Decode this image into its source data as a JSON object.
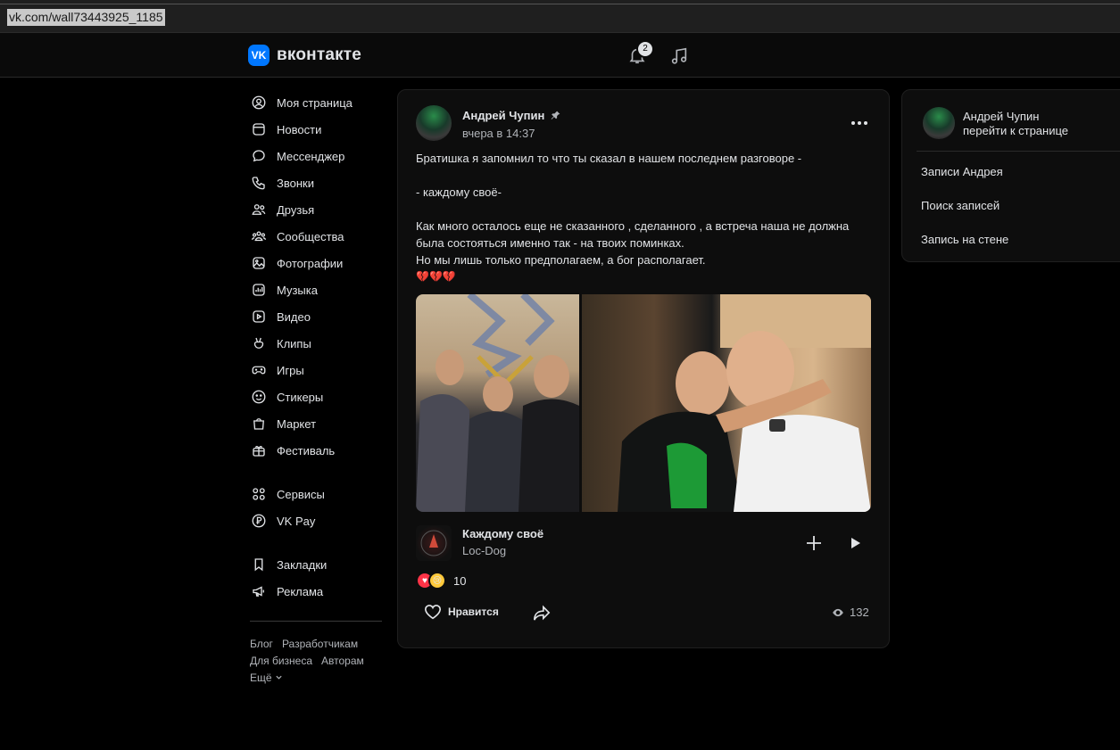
{
  "browser": {
    "url": "vk.com/wall73443925_1185"
  },
  "header": {
    "logo_mark": "VK",
    "logo_text": "вконтакте",
    "notifications_count": "2"
  },
  "leftnav": {
    "items": [
      {
        "label": "Моя страница",
        "icon": "user-circle-icon"
      },
      {
        "label": "Новости",
        "icon": "news-icon"
      },
      {
        "label": "Мессенджер",
        "icon": "message-icon"
      },
      {
        "label": "Звонки",
        "icon": "phone-icon"
      },
      {
        "label": "Друзья",
        "icon": "friends-icon"
      },
      {
        "label": "Сообщества",
        "icon": "communities-icon"
      },
      {
        "label": "Фотографии",
        "icon": "photo-icon"
      },
      {
        "label": "Музыка",
        "icon": "music-icon"
      },
      {
        "label": "Видео",
        "icon": "video-icon"
      },
      {
        "label": "Клипы",
        "icon": "clips-icon"
      },
      {
        "label": "Игры",
        "icon": "gamepad-icon"
      },
      {
        "label": "Стикеры",
        "icon": "smile-icon"
      },
      {
        "label": "Маркет",
        "icon": "bag-icon"
      },
      {
        "label": "Фестиваль",
        "icon": "gift-icon"
      }
    ],
    "services": [
      {
        "label": "Сервисы",
        "icon": "grid-icon"
      },
      {
        "label": "VK Pay",
        "icon": "ruble-icon"
      }
    ],
    "extra": [
      {
        "label": "Закладки",
        "icon": "bookmark-icon"
      },
      {
        "label": "Реклама",
        "icon": "megaphone-icon"
      }
    ],
    "footer": {
      "blog": "Блог",
      "developers": "Разработчикам",
      "business": "Для бизнеса",
      "authors": "Авторам",
      "more": "Ещё"
    }
  },
  "post": {
    "author": "Андрей Чупин",
    "date": "вчера в 14:37",
    "text": [
      "Братишка я запомнил то что ты сказал в нашем последнем разговоре -",
      "",
      "- каждому своё-",
      "",
      "Как много осталось еще не сказанного , сделанного , а встреча наша не должна",
      "была состояться именно так - на твоих поминках.",
      "Но мы лишь только предполагаем, а бог располагает."
    ],
    "emoji_line": "💔💔💔",
    "audio": {
      "title": "Каждому своё",
      "artist": "Loc-Dog"
    },
    "reactions_count": "10",
    "like_label": "Нравится",
    "views": "132"
  },
  "rightpanel": {
    "name": "Андрей Чупин",
    "link": "перейти к странице",
    "items": [
      "Записи Андрея",
      "Поиск записей",
      "Запись на стене"
    ]
  },
  "colors": {
    "accent": "#0077ff",
    "background": "#000000",
    "card": "#0d0d0d",
    "text": "#e1e3e6"
  }
}
